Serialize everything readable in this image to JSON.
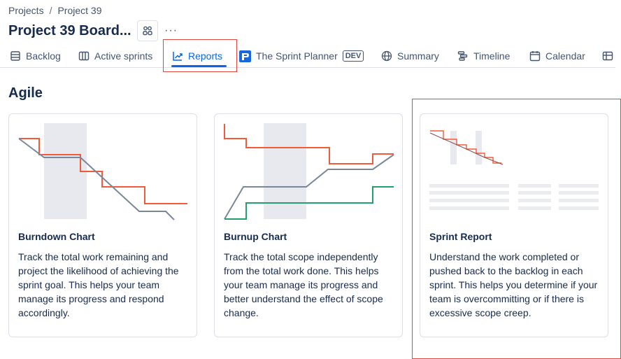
{
  "breadcrumb": {
    "items": [
      "Projects",
      "Project 39"
    ],
    "separator": "/"
  },
  "page": {
    "title": "Project 39 Board...",
    "more_label": "···"
  },
  "tabs": [
    {
      "label": "Backlog",
      "icon": "backlog-icon"
    },
    {
      "label": "Active sprints",
      "icon": "board-columns-icon"
    },
    {
      "label": "Reports",
      "icon": "trend-chart-icon",
      "active": true
    },
    {
      "label": "The Sprint Planner",
      "icon": "sprint-planner-app-icon",
      "badge": "DEV"
    },
    {
      "label": "Summary",
      "icon": "globe-icon"
    },
    {
      "label": "Timeline",
      "icon": "timeline-icon"
    },
    {
      "label": "Calendar",
      "icon": "calendar-icon"
    },
    {
      "label": "",
      "icon": "table-icon"
    }
  ],
  "section": {
    "title": "Agile"
  },
  "cards": [
    {
      "title": "Burndown Chart",
      "description": "Track the total work remaining and project the likelihood of achieving the sprint goal. This helps your team manage its progress and respond accordingly."
    },
    {
      "title": "Burnup Chart",
      "description": "Track the total scope independently from the total work done. This helps your team manage its progress and better understand the effect of scope change."
    },
    {
      "title": "Sprint Report",
      "description": "Understand the work completed or pushed back to the backlog in each sprint. This helps you determine if your team is overcommitting or if there is excessive scope creep."
    }
  ],
  "colors": {
    "accent": "#0c66e4",
    "highlight": "#e2483d",
    "scope_line": "#f15b3a",
    "work_line": "#7a869a",
    "done_line": "#22a06b"
  }
}
